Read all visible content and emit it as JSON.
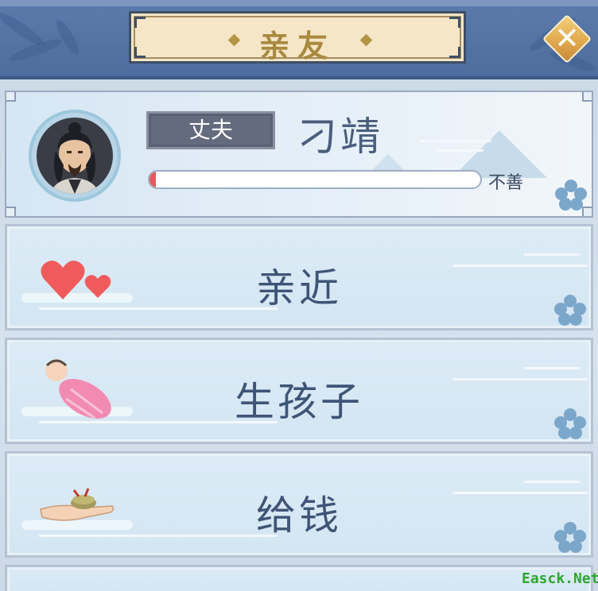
{
  "header": {
    "title": "亲友",
    "close_label": "✕"
  },
  "profile": {
    "role": "丈夫",
    "name": "刁靖",
    "favor_level": 0.02,
    "favor_label": "不善"
  },
  "actions": [
    {
      "label": "亲近",
      "icon": "hearts-icon"
    },
    {
      "label": "生孩子",
      "icon": "swaddled-baby-icon"
    },
    {
      "label": "给钱",
      "icon": "hand-coins-icon"
    }
  ],
  "watermark": "Easck.Net",
  "colors": {
    "header_bg": "#5a7bab",
    "title_plaque": "#f4e6c6",
    "title_text": "#a8893f",
    "close_button": "#dfa64b",
    "row_bg": "#dcebf6",
    "label_text": "#3e5577",
    "favor_fill": "#e55a5a"
  }
}
